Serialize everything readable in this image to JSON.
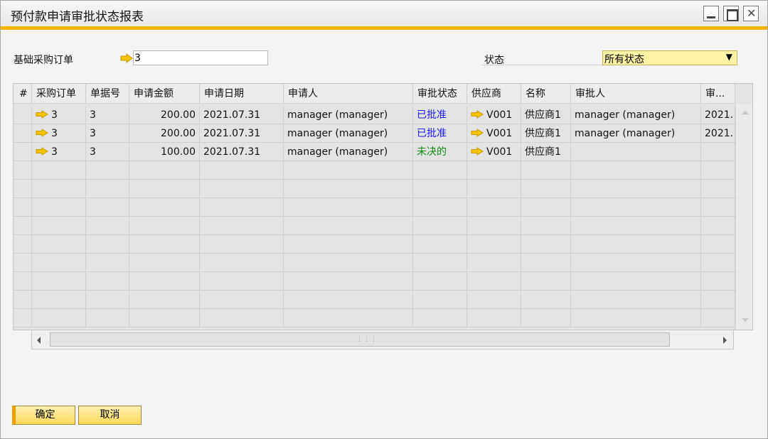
{
  "window": {
    "title": "预付款申请审批状态报表"
  },
  "filters": {
    "po_label": "基础采购订单",
    "po_value": "3",
    "status_label": "状态",
    "status_value": "所有状态"
  },
  "table": {
    "columns": [
      "#",
      "采购订单",
      "单据号",
      "申请金额",
      "申请日期",
      "申请人",
      "审批状态",
      "供应商",
      "名称",
      "审批人",
      "审..."
    ],
    "rows": [
      {
        "po": "3",
        "doc": "3",
        "amount": "200.00",
        "date": "2021.07.31",
        "applicant": "manager (manager)",
        "status": "已批准",
        "status_color": "#1a1aff",
        "vendor": "V001",
        "name": "供应商1",
        "approver": "manager (manager)",
        "approve_date": "2021."
      },
      {
        "po": "3",
        "doc": "3",
        "amount": "200.00",
        "date": "2021.07.31",
        "applicant": "manager (manager)",
        "status": "已批准",
        "status_color": "#1a1aff",
        "vendor": "V001",
        "name": "供应商1",
        "approver": "manager (manager)",
        "approve_date": "2021."
      },
      {
        "po": "3",
        "doc": "3",
        "amount": "100.00",
        "date": "2021.07.31",
        "applicant": "manager (manager)",
        "status": "未决的",
        "status_color": "#118811",
        "vendor": "V001",
        "name": "供应商1",
        "approver": "",
        "approve_date": ""
      }
    ],
    "empty_rows": 9
  },
  "buttons": {
    "ok": "确定",
    "cancel": "取消"
  },
  "colors": {
    "accent": "#f4b400",
    "select_bg": "#fff3a6",
    "link_arrow": "#f5c400"
  }
}
